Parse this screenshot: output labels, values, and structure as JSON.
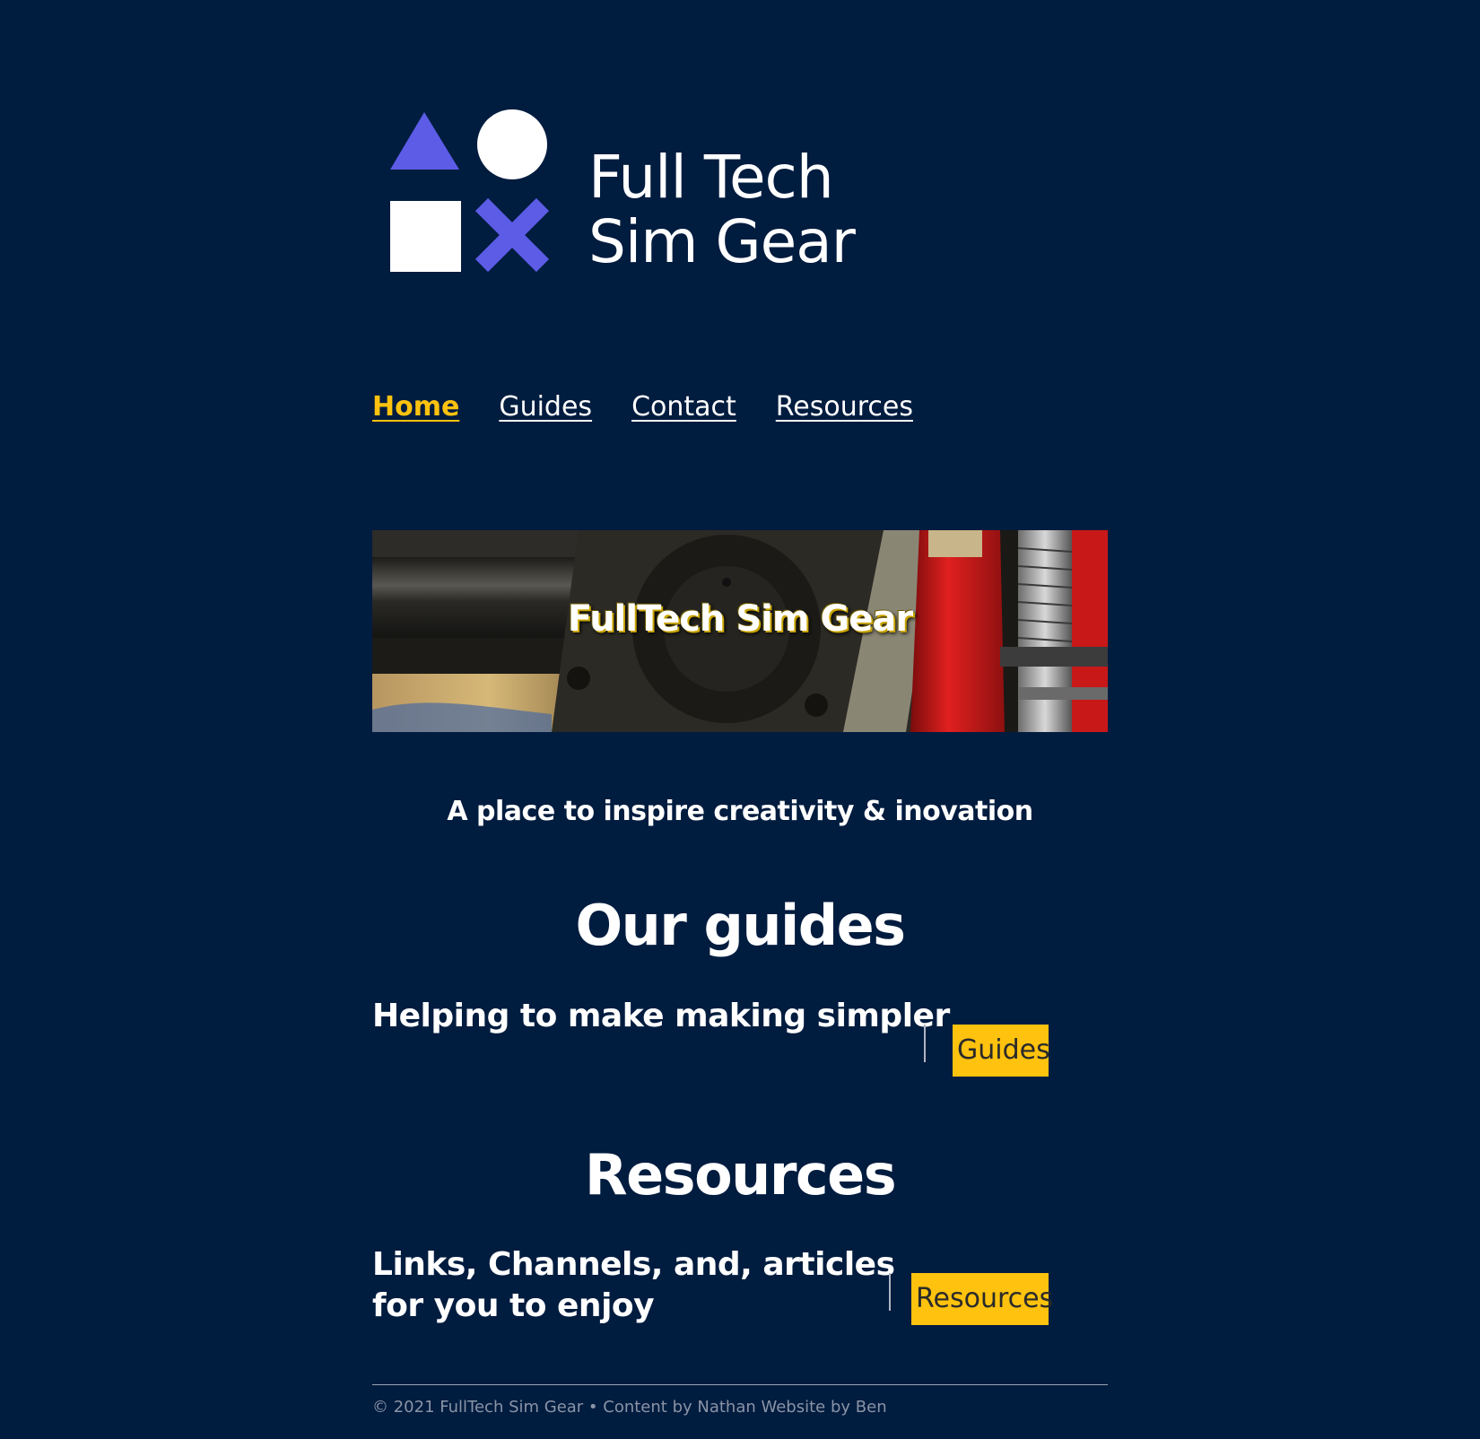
{
  "logo": {
    "line1": "Full Tech",
    "line2": "Sim Gear",
    "colors": {
      "accent": "#5c5ce6",
      "shape": "#ffffff"
    }
  },
  "nav": {
    "items": [
      {
        "label": "Home",
        "active": true
      },
      {
        "label": "Guides",
        "active": false
      },
      {
        "label": "Contact",
        "active": false
      },
      {
        "label": "Resources",
        "active": false
      }
    ]
  },
  "hero": {
    "title": "FullTech Sim Gear"
  },
  "tagline": "A place to inspire creativity & inovation",
  "guides": {
    "heading": "Our guides",
    "text": "Helping to make making simpler",
    "button": "Guides"
  },
  "resources": {
    "heading": "Resources",
    "text_line1": "Links, Channels, and, articles",
    "text_line2": "for you to enjoy",
    "button": "Resources"
  },
  "footer": {
    "text": "© 2021 FullTech Sim Gear • Content by Nathan Website by Ben"
  },
  "colors": {
    "background": "#001c3f",
    "accent": "#ffc20e",
    "text": "#ffffff"
  }
}
